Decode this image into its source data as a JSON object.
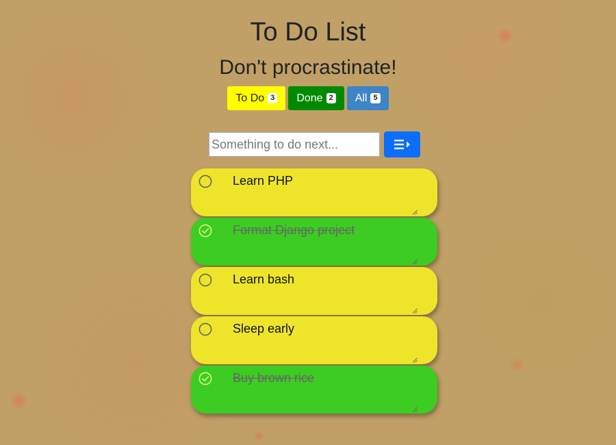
{
  "header": {
    "title": "To Do List",
    "subtitle": "Don't procrastinate!"
  },
  "filters": [
    {
      "label": "To Do",
      "count": "3",
      "color": "#ffff00"
    },
    {
      "label": "Done",
      "count": "2",
      "color": "#008a00"
    },
    {
      "label": "All",
      "count": "5",
      "color": "#3d85c6"
    }
  ],
  "add": {
    "placeholder": "Something to do next...",
    "button_icon": "list-arrow-icon",
    "button_color": "#0d6efd"
  },
  "tasks": [
    {
      "text": "Learn PHP",
      "done": false
    },
    {
      "text": "Format Django project",
      "done": true
    },
    {
      "text": "Learn bash",
      "done": false
    },
    {
      "text": "Sleep early",
      "done": false
    },
    {
      "text": "Buy brown rice",
      "done": true
    }
  ],
  "colors": {
    "open_task": "#eee52a",
    "done_task": "#3ccc22",
    "background": "#c0a066"
  }
}
